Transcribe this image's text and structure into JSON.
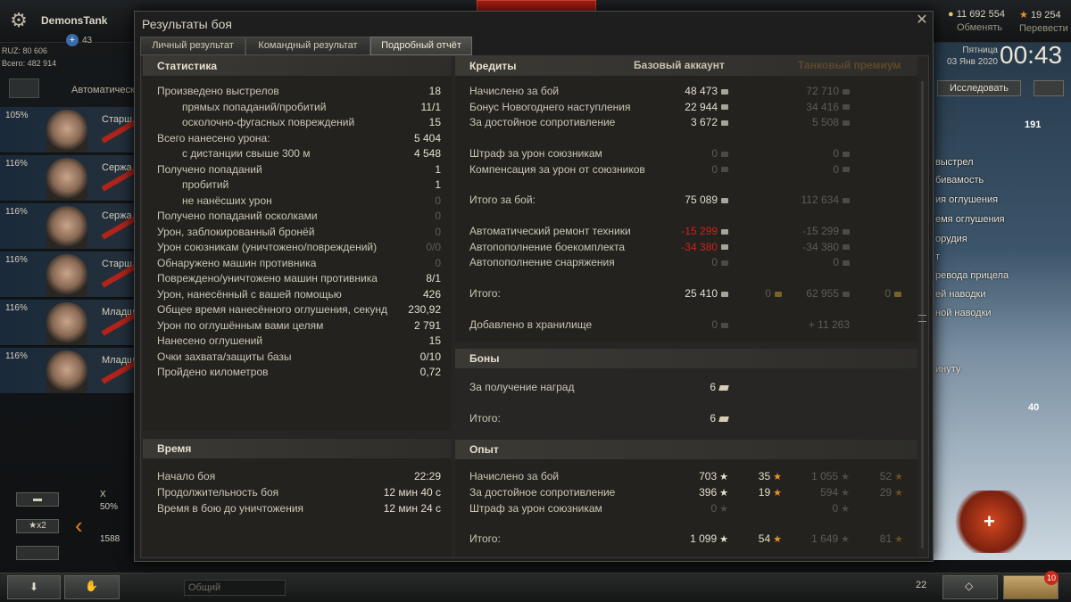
{
  "header": {
    "player_name": "DemonsTank",
    "premium_plus": "43",
    "gold": "11 692 554",
    "gold_action": "Обменять",
    "xp": "19 254",
    "xp_action": "Перевести"
  },
  "left": {
    "ruz": "RUZ: 80 606",
    "total": "Всего: 482 914",
    "crew_label": "Автоматически",
    "crew": [
      {
        "pct": "105%",
        "rank": "Старш"
      },
      {
        "pct": "116%",
        "rank": "Сержа"
      },
      {
        "pct": "116%",
        "rank": "Сержа"
      },
      {
        "pct": "116%",
        "rank": "Старш"
      },
      {
        "pct": "116%",
        "rank": "Младш"
      },
      {
        "pct": "116%",
        "rank": "Младш"
      }
    ],
    "x2_label": "x2",
    "tank_lines": [
      "X",
      "50%",
      "1588"
    ]
  },
  "right": {
    "day": "Пятница",
    "date": "03 Янв 2020",
    "clock": "00:43",
    "research": "Исследовать",
    "count_top": "191",
    "count_bottom": "40",
    "lines": [
      "выстрел",
      "бивамость",
      "ия оглушения",
      "емя оглушения",
      "орудия",
      "т",
      "ревода прицела",
      "ей наводки",
      "ной наводки",
      "инуту"
    ]
  },
  "bottom": {
    "chat_placeholder": "Общий",
    "players_count": "22",
    "notifications": "10"
  },
  "modal": {
    "title": "Результаты боя",
    "tabs": [
      "Личный результат",
      "Командный результат",
      "Подробный отчёт"
    ],
    "stats": {
      "header": "Статистика",
      "rows": [
        {
          "label": "Произведено выстрелов",
          "value": "18",
          "indent": false,
          "dim": false
        },
        {
          "label": "прямых попаданий/пробитий",
          "value": "11/1",
          "indent": true,
          "dim": false
        },
        {
          "label": "осколочно-фугасных повреждений",
          "value": "15",
          "indent": true,
          "dim": false
        },
        {
          "label": "Всего нанесено урона:",
          "value": "5 404",
          "indent": false,
          "dim": false
        },
        {
          "label": "с дистанции свыше 300 м",
          "value": "4 548",
          "indent": true,
          "dim": false
        },
        {
          "label": "Получено попаданий",
          "value": "1",
          "indent": false,
          "dim": false
        },
        {
          "label": "пробитий",
          "value": "1",
          "indent": true,
          "dim": false
        },
        {
          "label": "не нанёсших урон",
          "value": "0",
          "indent": true,
          "dim": true
        },
        {
          "label": "Получено попаданий осколками",
          "value": "0",
          "indent": false,
          "dim": true
        },
        {
          "label": "Урон, заблокированный бронёй",
          "value": "0",
          "indent": false,
          "dim": true
        },
        {
          "label": "Урон союзникам (уничтожено/повреждений)",
          "value": "0/0",
          "indent": false,
          "dim": true
        },
        {
          "label": "Обнаружено машин противника",
          "value": "0",
          "indent": false,
          "dim": true
        },
        {
          "label": "Повреждено/уничтожено машин противника",
          "value": "8/1",
          "indent": false,
          "dim": false
        },
        {
          "label": "Урон, нанесённый с вашей помощью",
          "value": "426",
          "indent": false,
          "dim": false
        },
        {
          "label": "Общее время нанесённого оглушения, секунд",
          "value": "230,92",
          "indent": false,
          "dim": false
        },
        {
          "label": "Урон по оглушённым вами целям",
          "value": "2 791",
          "indent": false,
          "dim": false
        },
        {
          "label": "Нанесено оглушений",
          "value": "15",
          "indent": false,
          "dim": false
        },
        {
          "label": "Очки захвата/защиты базы",
          "value": "0/10",
          "indent": false,
          "dim": false
        },
        {
          "label": "Пройдено километров",
          "value": "0,72",
          "indent": false,
          "dim": false
        }
      ]
    },
    "time": {
      "header": "Время",
      "rows": [
        {
          "label": "Начало боя",
          "value": "22:29"
        },
        {
          "label": "Продолжительность боя",
          "value": "12 мин 40 с"
        },
        {
          "label": "Время в бою до уничтожения",
          "value": "12 мин 24 с"
        }
      ]
    },
    "credits": {
      "header": "Кредиты",
      "col_base": "Базовый аккаунт",
      "col_prem": "Танковый премиум",
      "rows": [
        {
          "label": "Начислено за бой",
          "base": "48 473",
          "base_dim": false,
          "base_red": false,
          "prem": "72 710",
          "extra": false
        },
        {
          "label": "Бонус Новогоднего наступления",
          "base": "22 944",
          "base_dim": false,
          "base_red": false,
          "prem": "34 416",
          "extra": false
        },
        {
          "label": "За достойное сопротивление",
          "base": "3 672",
          "base_dim": false,
          "base_red": false,
          "prem": "5 508",
          "extra": false
        },
        {
          "label": "Штраф за урон союзникам",
          "base": "0",
          "base_dim": true,
          "base_red": false,
          "prem": "0",
          "extra": false
        },
        {
          "label": "Компенсация за урон от союзников",
          "base": "0",
          "base_dim": true,
          "base_red": false,
          "prem": "0",
          "extra": false
        },
        {
          "label": "Итого за бой:",
          "base": "75 089",
          "base_dim": false,
          "base_red": false,
          "prem": "112 634",
          "extra": false
        },
        {
          "label": "Автоматический ремонт техники",
          "base": "-15 299",
          "base_dim": false,
          "base_red": true,
          "prem": "-15 299",
          "extra": false
        },
        {
          "label": "Автопополнение боекомплекта",
          "base": "-34 380",
          "base_dim": false,
          "base_red": true,
          "prem": "-34 380",
          "extra": false
        },
        {
          "label": "Автопополнение снаряжения",
          "base": "0",
          "base_dim": true,
          "base_red": false,
          "prem": "0",
          "extra": false
        },
        {
          "label": "Итого:",
          "base": "25 410",
          "base_dim": false,
          "base_red": false,
          "prem": "62 955",
          "extra": true,
          "extra_base": "0",
          "extra_prem": "0"
        },
        {
          "label": "Добавлено в хранилище",
          "base": "0",
          "base_dim": true,
          "base_red": false,
          "prem": "+ 11 263",
          "extra": false
        }
      ]
    },
    "bonds": {
      "header": "Боны",
      "rows": [
        {
          "label": "За получение наград",
          "value": "6"
        },
        {
          "label": "Итого:",
          "value": "6"
        }
      ]
    },
    "xp": {
      "header": "Опыт",
      "rows": [
        {
          "label": "Начислено за бой",
          "base": "703",
          "base_dim": false,
          "free": "35",
          "free_dim": false,
          "prem": "1 055",
          "prem_free": "52"
        },
        {
          "label": "За достойное сопротивление",
          "base": "396",
          "base_dim": false,
          "free": "19",
          "free_dim": false,
          "prem": "594",
          "prem_free": "29"
        },
        {
          "label": "Штраф за урон союзникам",
          "base": "0",
          "base_dim": true,
          "free": "",
          "free_dim": true,
          "prem": "0",
          "prem_free": ""
        },
        {
          "label": "Итого:",
          "base": "1 099",
          "base_dim": false,
          "free": "54",
          "free_dim": false,
          "prem": "1 649",
          "prem_free": "81"
        }
      ]
    }
  }
}
